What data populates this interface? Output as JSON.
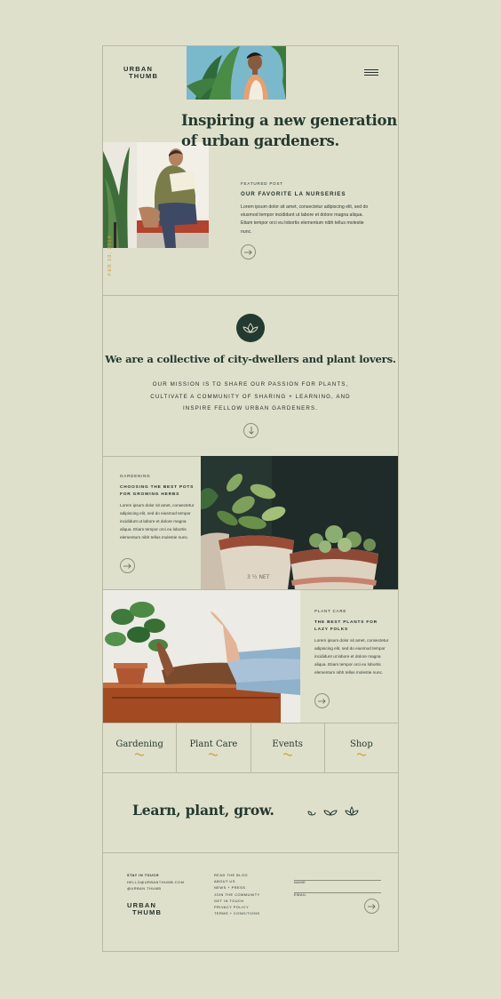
{
  "brand": {
    "line1": "URBAN",
    "line2": "THUMB"
  },
  "hero": {
    "headline_line1": "Inspiring a new generation",
    "headline_line2": "of urban gardeners.",
    "date_label": "FEB 10, 2019"
  },
  "featured": {
    "kicker": "FEATURED POST",
    "title": "OUR FAVORITE LA NURSERIES",
    "body": "Lorem ipsum dolor sit amet, consectetur adipiscing elit, sed do eiusmod tempor incididunt ut labore et dolore magna aliqua. Etiam tempor orci eu lobortis elementum nibh tellus molestie nunc."
  },
  "mission": {
    "headline": "We are a collective of city-dwellers and plant lovers.",
    "line1": "OUR MISSION IS TO SHARE OUR PASSION FOR PLANTS,",
    "line2": "CULTIVATE A COMMUNITY OF SHARING + LEARNING, AND",
    "line3": "INSPIRE FELLOW URBAN GARDENERS."
  },
  "post_gardening": {
    "kicker": "GARDENING",
    "title_line1": "CHOOSING THE BEST POTS",
    "title_line2": "FOR GROWING HERBS",
    "body": "Lorem ipsum dolor sit amet, consectetur adipiscing elit, sed do eiusmod tempor incididunt ut labore et dolore magna aliqua. Etiam tempor orci eu lobortis elementum nibh tellus molestie nunc."
  },
  "post_plantcare": {
    "kicker": "PLANT CARE",
    "title_line1": "THE BEST PLANTS FOR",
    "title_line2": "LAZY FOLKS",
    "body": "Lorem ipsum dolor sit amet, consectetur adipiscing elit, sed do eiusmod tempor incididunt ut labore et dolore magna aliqua. Etiam tempor orci eu lobortis elementum nibh tellus molestie nunc."
  },
  "categories": [
    {
      "label": "Gardening"
    },
    {
      "label": "Plant Care"
    },
    {
      "label": "Events"
    },
    {
      "label": "Shop"
    }
  ],
  "tagline": "Learn, plant, grow.",
  "footer": {
    "contact": [
      "STAY IN TOUCH",
      "HELLO@URBANTHUMB.COM",
      "@URBAN.THUMB"
    ],
    "links": [
      "READ THE BLOG",
      "ABOUT US",
      "NEWS + PRESS",
      "JOIN THE COMMUNITY",
      "GET IN TOUCH",
      "PRIVACY POLICY",
      "TERMS + CONDITIONS"
    ],
    "name_label": "NAME",
    "email_label": "EMAIL"
  },
  "colors": {
    "background": "#dfe0cc",
    "dark_green": "#24392f",
    "accent_gold": "#c9a227",
    "line": "#b7b9a3"
  }
}
